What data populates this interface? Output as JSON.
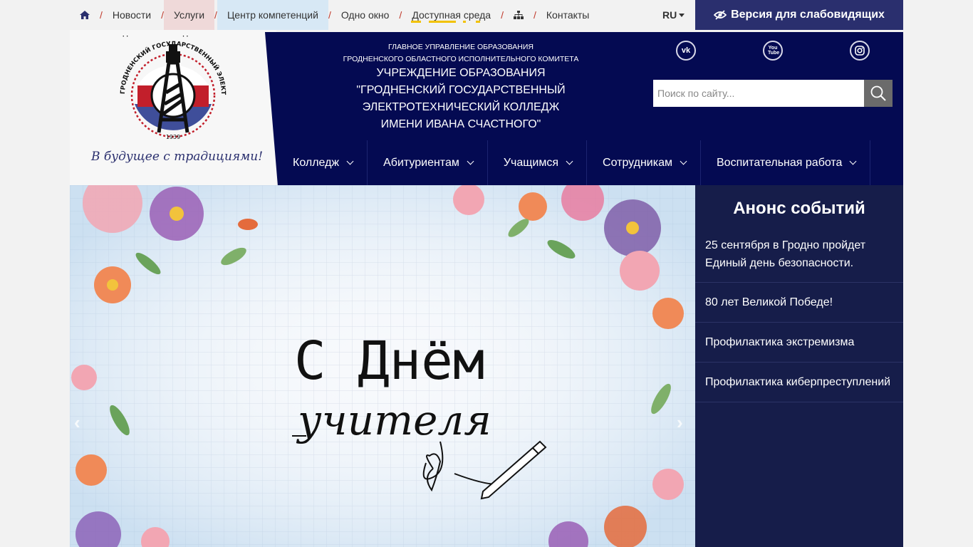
{
  "topnav": {
    "items": [
      "Новости",
      "Услуги",
      "Центр компетенций",
      "Одно окно",
      "Доступная среда",
      "Контакты"
    ]
  },
  "lang": "RU",
  "low_vision": "Версия для слабовидящих",
  "logo": {
    "slogan": "В будущее с традициями!",
    "ring_text": "ГРОДНЕНСКИЙ ГОСУДАРСТВЕННЫЙ ЭЛЕКТРОТЕХНИЧЕСКИЙ КОЛЛЕДЖ",
    "year": "1939"
  },
  "header": {
    "sub_line1": "ГЛАВНОЕ УПРАВЛЕНИЕ ОБРАЗОВАНИЯ",
    "sub_line2": "ГРОДНЕНСКОГО ОБЛАСТНОГО ИСПОЛНИТЕЛЬНОГО КОМИТЕТА",
    "main_line1": "УЧРЕЖДЕНИЕ ОБРАЗОВАНИЯ",
    "main_line2": "\"ГРОДНЕНСКИЙ ГОСУДАРСТВЕННЫЙ",
    "main_line3": "ЭЛЕКТРОТЕХНИЧЕСКИЙ КОЛЛЕДЖ",
    "main_line4": "ИМЕНИ ИВАНА СЧАСТНОГО\""
  },
  "social": {
    "vk": "vk",
    "youtube": "You Tube"
  },
  "search": {
    "placeholder": "Поиск по сайту..."
  },
  "mainnav": {
    "items": [
      "Колледж",
      "Абитуриентам",
      "Учащимся",
      "Сотрудникам",
      "Воспитательная работа"
    ]
  },
  "banner": {
    "line1": "С Днём",
    "line2": "учителя"
  },
  "events": {
    "title": "Анонс событий",
    "items": [
      "25 сентября в Гродно пройдет Единый день безопасности.",
      "80 лет Великой Победе!",
      "Профилактика экстремизма",
      "Профилактика киберпреступлений"
    ]
  },
  "colors": {
    "header_bg": "#040a52",
    "events_bg": "#161d4a",
    "low_vision_bg": "#2a2f6e",
    "separator": "#c0392b",
    "highlight_underline": "#f2c200"
  },
  "icons": {
    "home": "home-icon",
    "sitemap": "sitemap-icon",
    "eye": "eye-slash-icon",
    "search": "search-icon",
    "vk": "vk-icon",
    "youtube": "youtube-icon",
    "instagram": "instagram-icon"
  }
}
